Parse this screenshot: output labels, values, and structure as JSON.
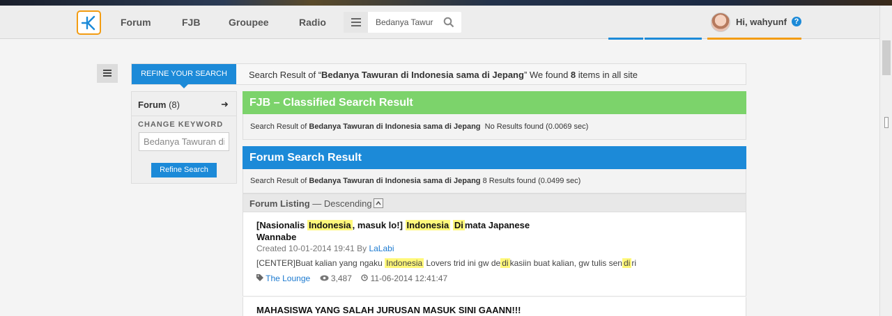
{
  "header": {
    "nav": [
      "Forum",
      "FJB",
      "Groupee",
      "Radio"
    ],
    "search_query": "Bedanya Tawur",
    "greeting": "Hi, wahyunf",
    "help": "?"
  },
  "colors": {
    "brand_blue": "#1c8ad8",
    "fjb_green": "#7cd36b",
    "logo_orange": "#f39c12",
    "highlight": "#fff87a"
  },
  "search_bar": {
    "refine_tab": "REFINE YOUR SEARCH",
    "summary_prefix": "Search Result of “",
    "summary_query": "Bedanya Tawuran di Indonesia sama di Jepang",
    "summary_mid": "” We found ",
    "summary_count": "8",
    "summary_suffix": " items in all site"
  },
  "left_panel": {
    "forum_label": "Forum",
    "forum_count": "(8)",
    "change_keyword": "CHANGE KEYWORD",
    "keyword_value": "Bedanya Tawuran di Indonesia sama di Jepang",
    "refine_button": "Refine Search"
  },
  "fjb": {
    "title": "FJB – Classified Search Result",
    "result_prefix": "Search Result of ",
    "result_query": "Bedanya Tawuran di Indonesia sama di Jepang",
    "result_status": "No Results found (0.0069 sec)"
  },
  "forum": {
    "title": "Forum Search Result",
    "result_prefix": "Search Result of ",
    "result_query": "Bedanya Tawuran di Indonesia sama di Jepang",
    "result_status": "8 Results found (0.0499 sec)",
    "listing_label": "Forum Listing",
    "listing_order": "— Descending"
  },
  "threads": [
    {
      "title_p1": "[Nasionalis ",
      "title_h1": "Indonesia",
      "title_p2": ", masuk lo!] ",
      "title_h2": "Indonesia",
      "title_p3": " ",
      "title_h3": "Di",
      "title_p4": "mata Japanese",
      "title_line2": "Wannabe",
      "created": "Created 10-01-2014 19:41 By ",
      "author": "LaLabi",
      "snip_p1": "[CENTER]Buat kalian yang ngaku ",
      "snip_h1": "Indonesia",
      "snip_p2": " Lovers trid ini gw de",
      "snip_h2": "di",
      "snip_p3": "kasiin buat kalian, gw tulis sen",
      "snip_h3": "di",
      "snip_p4": "ri",
      "category": "The Lounge",
      "views": "3,487",
      "last_post": "11-06-2014 12:41:47"
    },
    {
      "title": "MAHASISWA YANG SALAH JURUSAN MASUK SINI GAANN!!!"
    }
  ]
}
